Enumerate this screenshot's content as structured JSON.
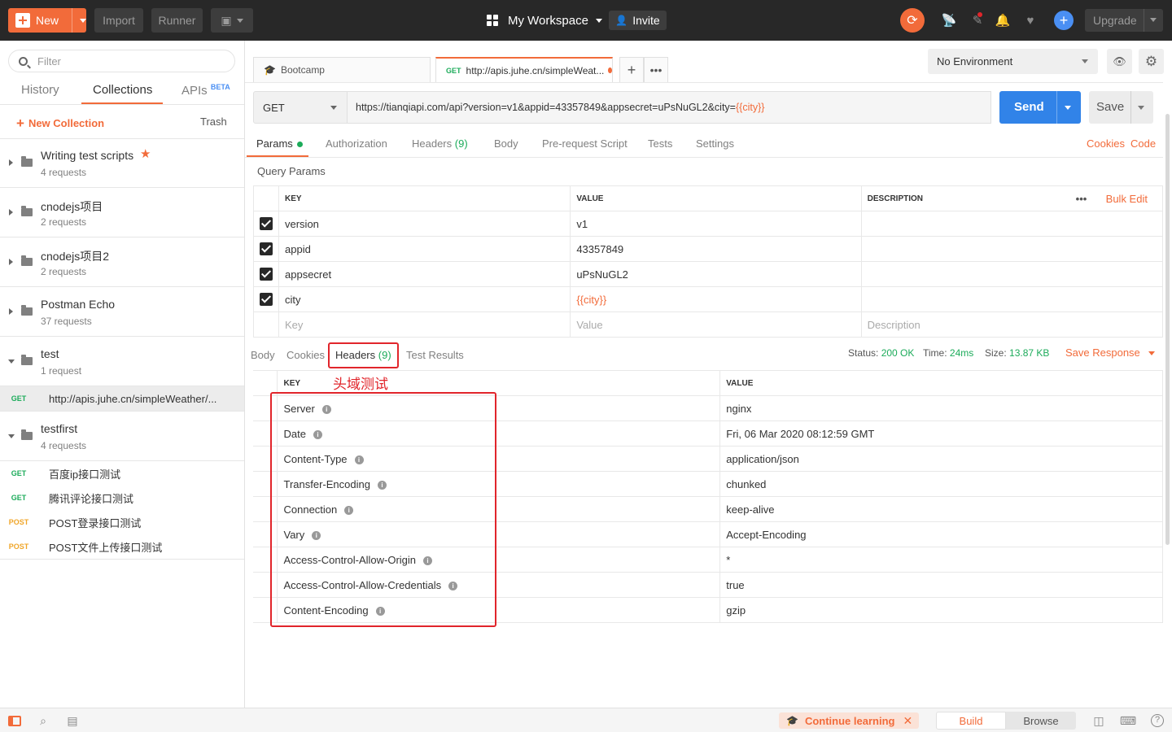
{
  "topbar": {
    "new_label": "New",
    "import_label": "Import",
    "runner_label": "Runner",
    "workspace_label": "My Workspace",
    "invite_label": "Invite",
    "upgrade_label": "Upgrade"
  },
  "sidebar": {
    "filter_placeholder": "Filter",
    "tabs": [
      "History",
      "Collections",
      "APIs"
    ],
    "beta_label": "BETA",
    "active_tab": "Collections",
    "new_collection_label": "New Collection",
    "trash_label": "Trash",
    "collections": [
      {
        "name": "Writing test scripts",
        "count": "4 requests",
        "starred": true,
        "expanded": false
      },
      {
        "name": "cnodejs项目",
        "count": "2 requests",
        "starred": false,
        "expanded": false
      },
      {
        "name": "cnodejs项目2",
        "count": "2 requests",
        "starred": false,
        "expanded": false
      },
      {
        "name": "Postman Echo",
        "count": "37 requests",
        "starred": false,
        "expanded": false
      },
      {
        "name": "test",
        "count": "1 request",
        "starred": false,
        "expanded": true
      },
      {
        "name": "testfirst",
        "count": "4 requests",
        "starred": false,
        "expanded": true
      }
    ],
    "test_requests": [
      {
        "method": "GET",
        "name": "http://apis.juhe.cn/simpleWeather/..."
      }
    ],
    "testfirst_requests": [
      {
        "method": "GET",
        "name": "百度ip接口测试"
      },
      {
        "method": "GET",
        "name": "腾讯评论接口测试"
      },
      {
        "method": "POST",
        "name": "POST登录接口测试"
      },
      {
        "method": "POST",
        "name": "POST文件上传接口测试"
      }
    ]
  },
  "request_tabs": [
    {
      "label": "Bootcamp",
      "method": ""
    },
    {
      "label": "http://apis.juhe.cn/simpleWeat...",
      "method": "GET"
    }
  ],
  "environment": {
    "selected": "No Environment"
  },
  "request": {
    "method": "GET",
    "url_prefix": "https://tianqiapi.com/api?version=v1&appid=43357849&appsecret=uPsNuGL2&city=",
    "url_var": "{{city}}",
    "send_label": "Send",
    "save_label": "Save"
  },
  "request_subtabs": {
    "params": "Params",
    "authorization": "Authorization",
    "headers": "Headers",
    "headers_count": "(9)",
    "body": "Body",
    "prerequest": "Pre-request Script",
    "tests": "Tests",
    "settings": "Settings",
    "cookies_link": "Cookies",
    "code_link": "Code"
  },
  "query_params": {
    "title": "Query Params",
    "columns": [
      "KEY",
      "VALUE",
      "DESCRIPTION"
    ],
    "bulk_edit": "Bulk Edit",
    "rows": [
      {
        "key": "version",
        "value": "v1",
        "var": false
      },
      {
        "key": "appid",
        "value": "43357849",
        "var": false
      },
      {
        "key": "appsecret",
        "value": "uPsNuGL2",
        "var": false
      },
      {
        "key": "city",
        "value": "{{city}}",
        "var": true
      }
    ],
    "placeholders": {
      "key": "Key",
      "value": "Value",
      "description": "Description"
    }
  },
  "response": {
    "tabs": {
      "body": "Body",
      "cookies": "Cookies",
      "headers": "Headers",
      "headers_count": "(9)",
      "test_results": "Test Results"
    },
    "status_label": "Status:",
    "status_value": "200 OK",
    "time_label": "Time:",
    "time_value": "24ms",
    "size_label": "Size:",
    "size_value": "13.87 KB",
    "save_response": "Save Response",
    "annotation": "头域测试",
    "columns": [
      "KEY",
      "VALUE"
    ],
    "headers": [
      {
        "key": "Server",
        "value": "nginx"
      },
      {
        "key": "Date",
        "value": "Fri, 06 Mar 2020 08:12:59 GMT"
      },
      {
        "key": "Content-Type",
        "value": "application/json"
      },
      {
        "key": "Transfer-Encoding",
        "value": "chunked"
      },
      {
        "key": "Connection",
        "value": "keep-alive"
      },
      {
        "key": "Vary",
        "value": "Accept-Encoding"
      },
      {
        "key": "Access-Control-Allow-Origin",
        "value": "*"
      },
      {
        "key": "Access-Control-Allow-Credentials",
        "value": "true"
      },
      {
        "key": "Content-Encoding",
        "value": "gzip"
      }
    ]
  },
  "statusbar": {
    "continue_learning": "Continue learning",
    "build": "Build",
    "browse": "Browse"
  },
  "colors": {
    "accent": "#f26b3a",
    "primary": "#3183e8",
    "get": "#1cab5a",
    "post": "#f0a62a",
    "annotation": "#e1252b"
  }
}
